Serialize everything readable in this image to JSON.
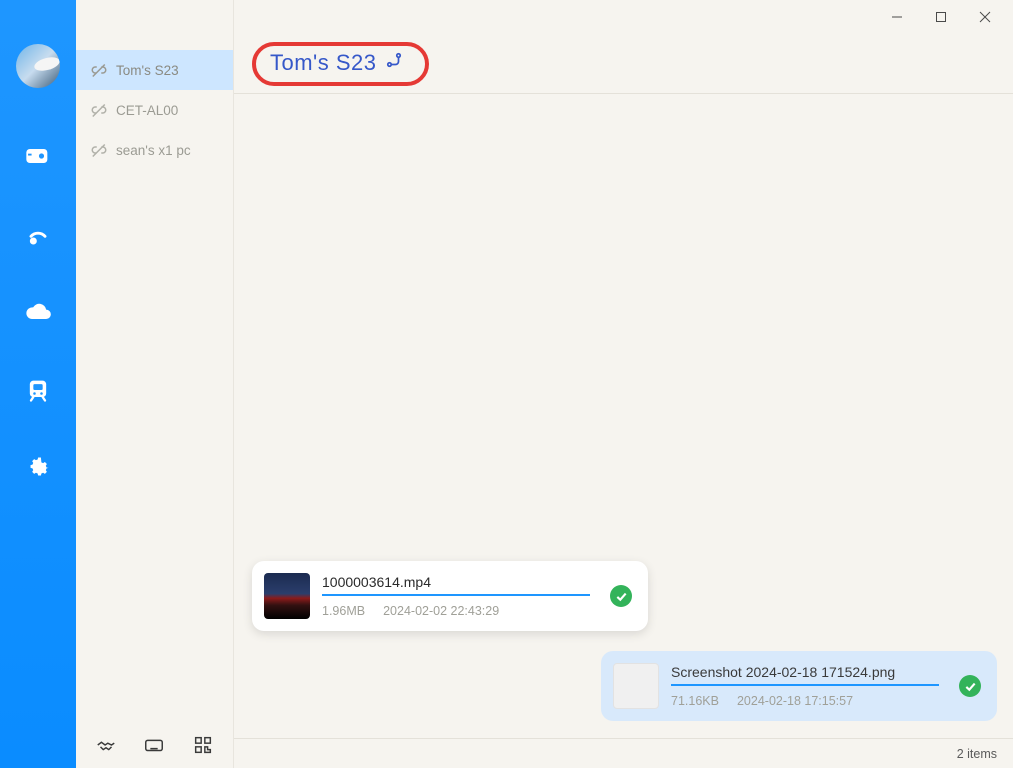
{
  "sidebar": {
    "icons": [
      "camera-icon",
      "radar-icon",
      "cloud-icon",
      "transit-icon",
      "gear-icon"
    ]
  },
  "devices": {
    "items": [
      {
        "label": "Tom's S23",
        "selected": true
      },
      {
        "label": "CET-AL00",
        "selected": false
      },
      {
        "label": "sean's x1 pc",
        "selected": false
      }
    ]
  },
  "header": {
    "device_name": "Tom's S23"
  },
  "files": [
    {
      "direction": "incoming",
      "name": "1000003614.mp4",
      "size": "1.96MB",
      "time": "2024-02-02 22:43:29",
      "thumb": "video",
      "status": "done"
    },
    {
      "direction": "outgoing",
      "name": "Screenshot 2024-02-18 171524.png",
      "size": "71.16KB",
      "time": "2024-02-18 17:15:57",
      "thumb": "blank",
      "status": "done"
    }
  ],
  "status": {
    "items_text": "2 items"
  },
  "window": {
    "min": "–",
    "max": "□",
    "close": "✕"
  },
  "bottom_tools": [
    "handshake-icon",
    "keyboard-icon",
    "qr-icon"
  ]
}
